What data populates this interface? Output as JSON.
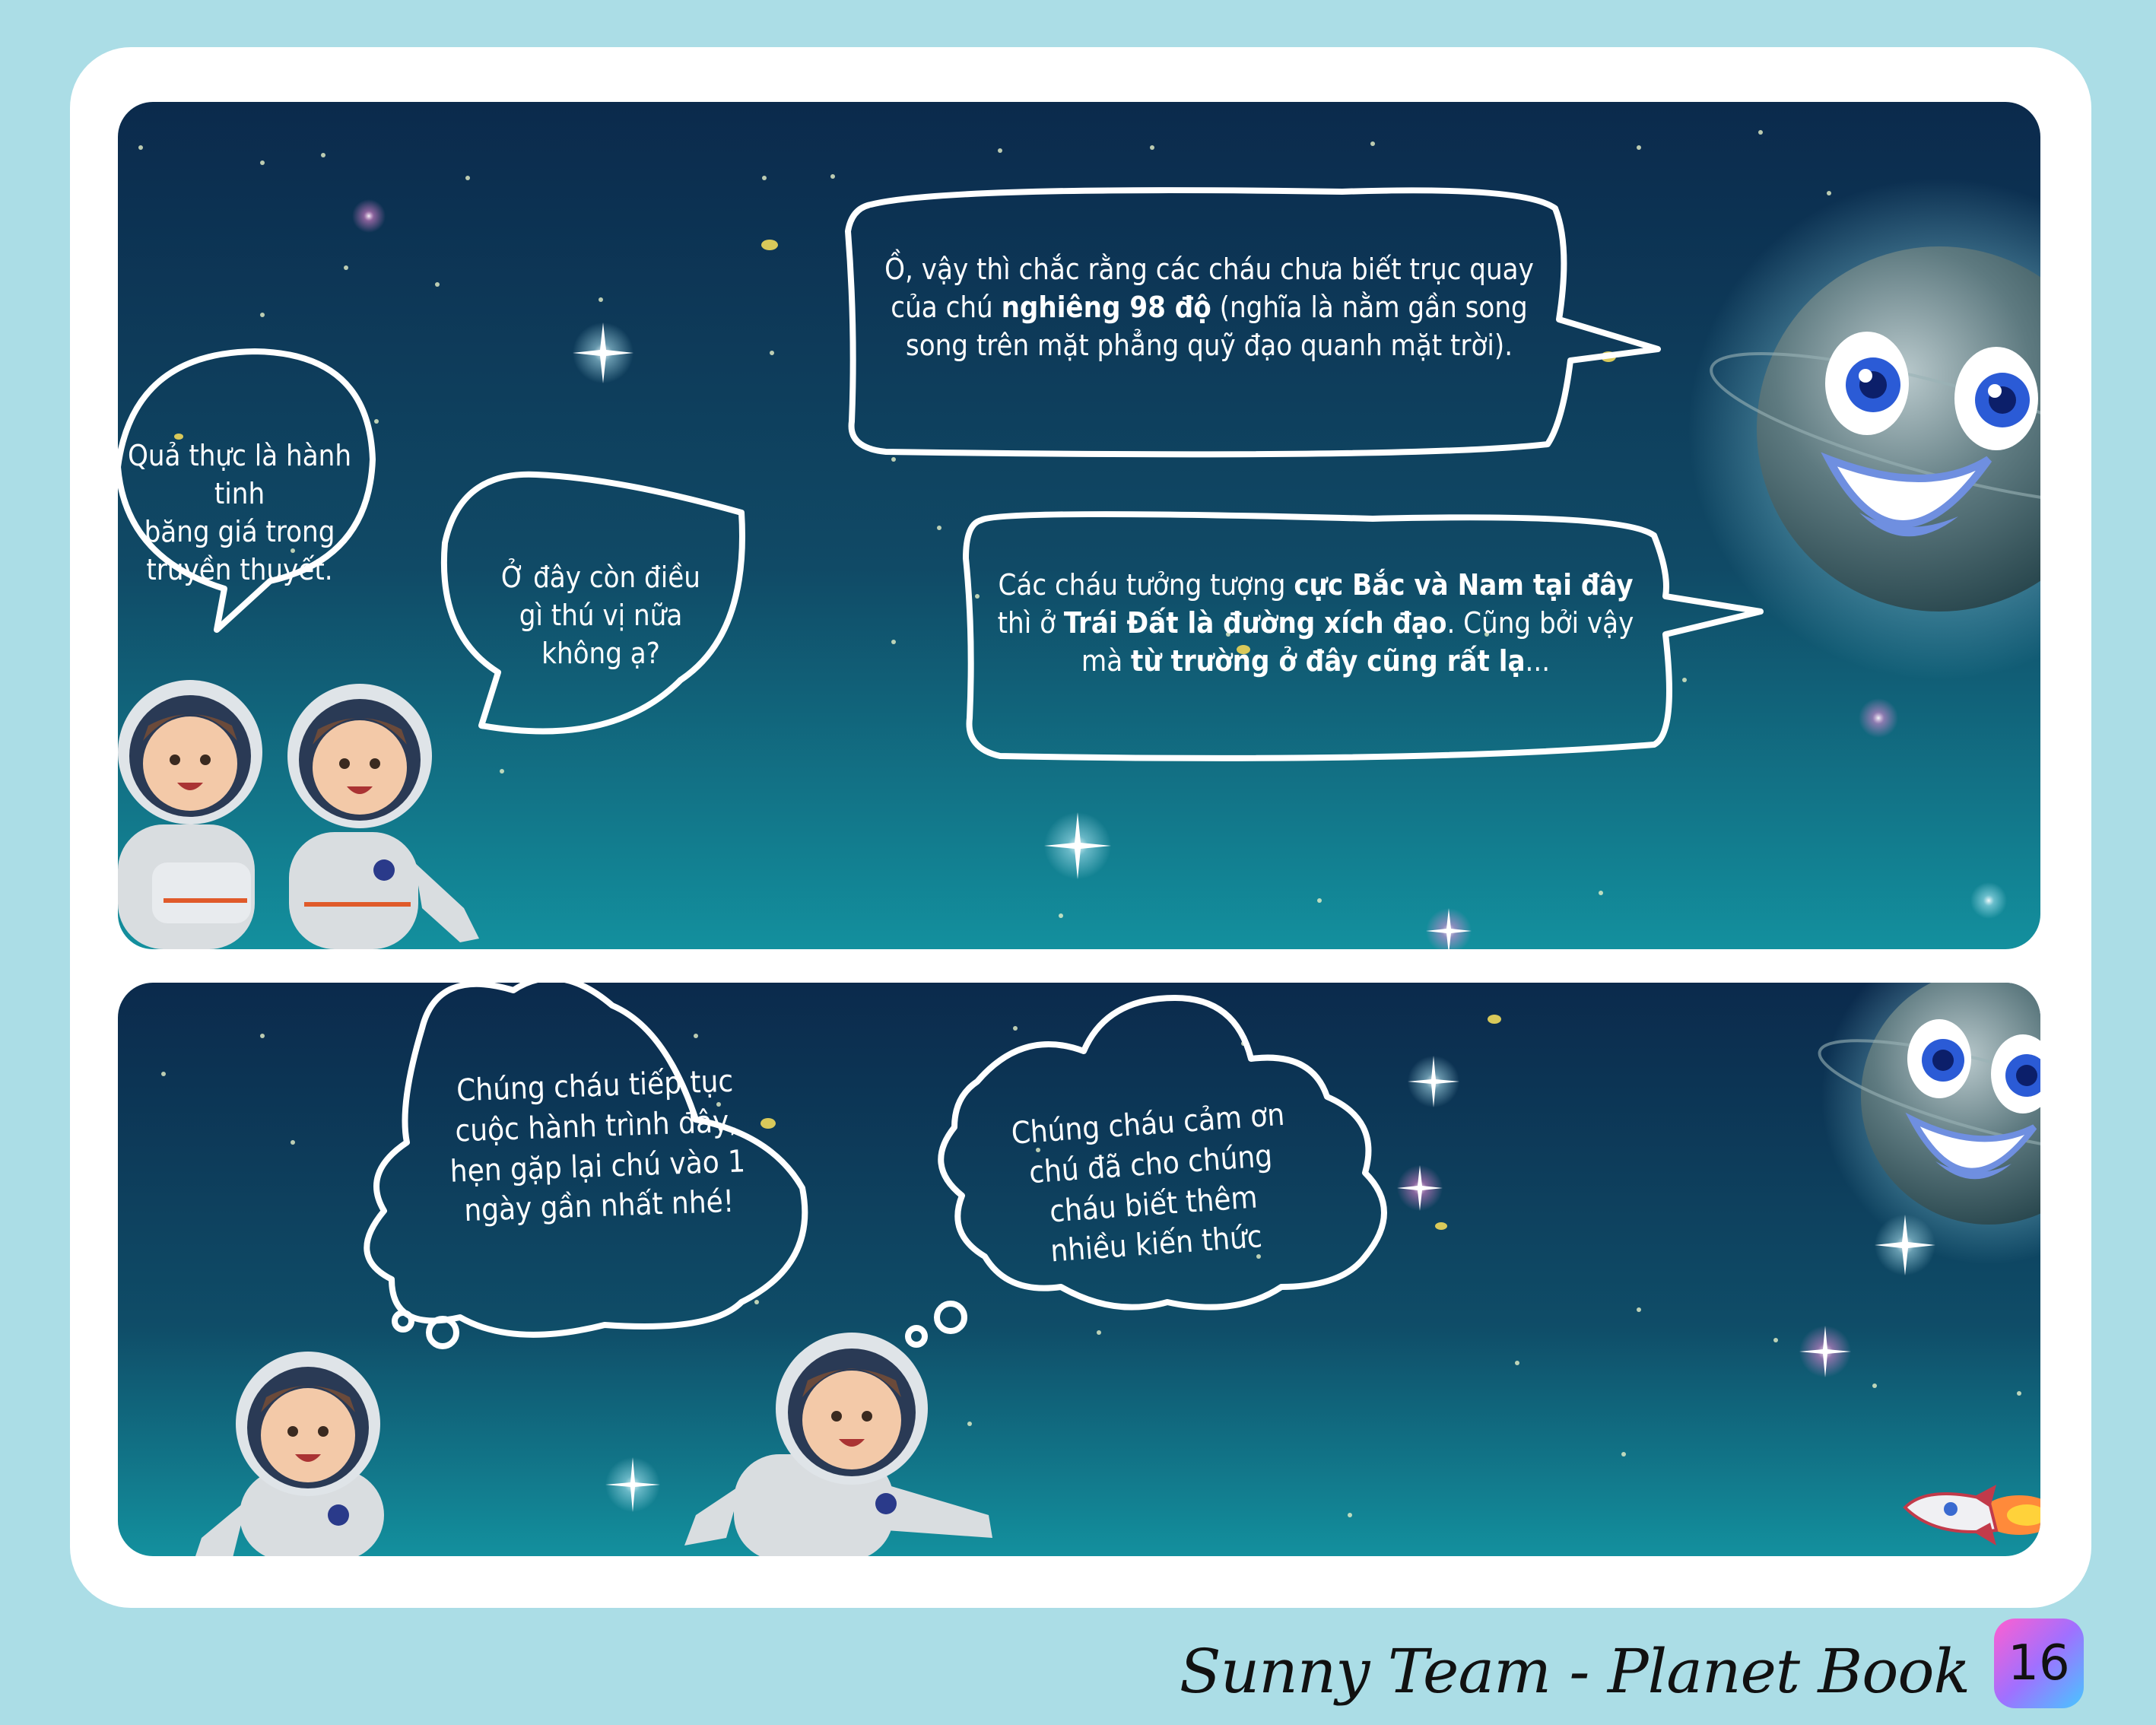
{
  "footer": {
    "title": "Sunny Team - Planet Book",
    "page_number": "16"
  },
  "panel_top": {
    "kid_bubble_1": [
      "Quả thực là hành tinh",
      "băng giá trong",
      "truyền thuyết."
    ],
    "kid_bubble_2": [
      "Ở đây còn điều",
      "gì thú vị nữa",
      "không ạ?"
    ],
    "planet_bubble_1": {
      "line1": "Ồ, vậy thì chắc rằng các cháu chưa biết trục quay",
      "line2_pre": "của chú ",
      "line2_bold": "nghiêng 98 độ",
      "line2_post": " (nghĩa là nằm gần song",
      "line3": "song trên mặt phẳng quỹ đạo quanh mặt trời)."
    },
    "planet_bubble_2": {
      "line1_pre": "Các cháu tưởng tượng ",
      "line1_bold": "cực Bắc và Nam tại đây",
      "line2_pre": "thì ở ",
      "line2_bold": "Trái Đất là đường xích đạo",
      "line2_post": ". Cũng bởi vậy",
      "line3_pre": "mà ",
      "line3_bold": "từ trường ở đây cũng rất lạ",
      "line3_post": "..."
    }
  },
  "panel_bottom": {
    "thought_1": [
      "Chúng cháu tiếp tục",
      "cuộc hành trình đây,",
      "hẹn gặp lại chú vào 1",
      "ngày gần nhất nhé!"
    ],
    "thought_2": [
      "Chúng cháu cảm ơn",
      "chú đã cho chúng",
      "cháu biết thêm",
      "nhiều kiến thức"
    ]
  },
  "colors": {
    "space_top": "#0b2a4c",
    "space_bottom": "#128a9a",
    "page_bg": "#abdde6",
    "bubble_stroke": "#ffffff"
  },
  "icons": [
    "astronaut-illustration",
    "smiling-planet-illustration",
    "rocket-icon",
    "star-sparkle-icon"
  ]
}
